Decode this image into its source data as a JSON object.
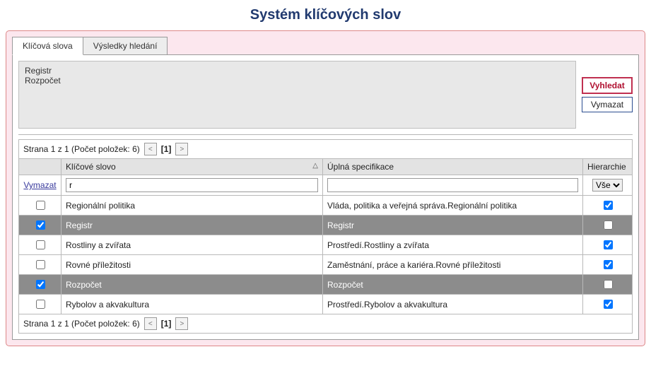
{
  "title": "Systém klíčových slov",
  "tabs": {
    "keywords": "Klíčová slova",
    "results": "Výsledky hledání"
  },
  "selection": {
    "items": [
      "Registr",
      "Rozpočet"
    ]
  },
  "buttons": {
    "search": "Vyhledat",
    "clear": "Vymazat"
  },
  "pager": {
    "text": "Strana 1 z 1 (Počet položek: 6)",
    "current": "[1]"
  },
  "headers": {
    "keyword": "Klíčové slovo",
    "fullspec": "Úplná specifikace",
    "hierarchy": "Hierarchie"
  },
  "filter": {
    "clear_label": "Vymazat",
    "keyword_value": "r",
    "fullspec_value": "",
    "hier_options": [
      "Vše"
    ],
    "hier_selected": "Vše"
  },
  "rows": [
    {
      "checked": false,
      "sel": false,
      "name": "Regionální politika",
      "full": "Vláda, politika a veřejná správa.Regionální politika",
      "hier": true
    },
    {
      "checked": true,
      "sel": true,
      "name": "Registr",
      "full": "Registr",
      "hier": false
    },
    {
      "checked": false,
      "sel": false,
      "name": "Rostliny a zvířata",
      "full": "Prostředí.Rostliny a zvířata",
      "hier": true
    },
    {
      "checked": false,
      "sel": false,
      "name": "Rovné příležitosti",
      "full": "Zaměstnání, práce a kariéra.Rovné příležitosti",
      "hier": true
    },
    {
      "checked": true,
      "sel": true,
      "name": "Rozpočet",
      "full": "Rozpočet",
      "hier": false
    },
    {
      "checked": false,
      "sel": false,
      "name": "Rybolov a akvakultura",
      "full": "Prostředí.Rybolov a akvakultura",
      "hier": true
    }
  ]
}
